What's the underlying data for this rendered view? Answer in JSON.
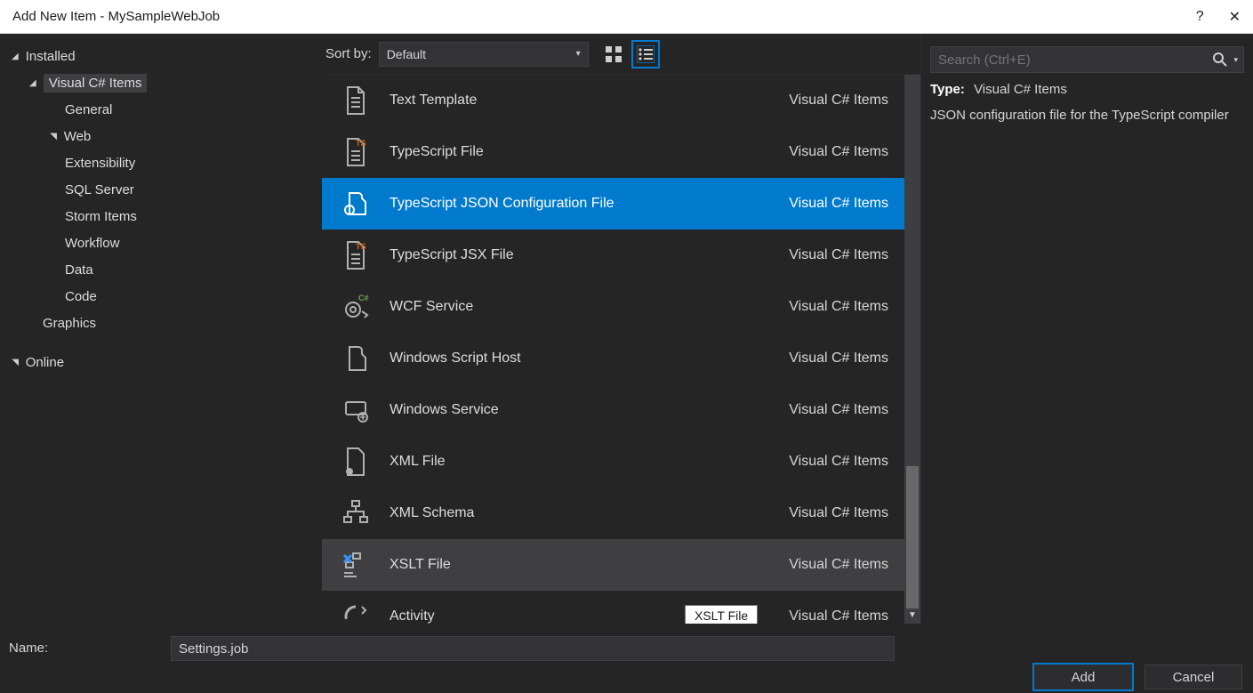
{
  "window": {
    "title": "Add New Item - MySampleWebJob"
  },
  "sidebar": {
    "installed": "Installed",
    "csharp": "Visual C# Items",
    "items": [
      "General",
      "Web",
      "Extensibility",
      "SQL Server",
      "Storm Items",
      "Workflow",
      "Data",
      "Code"
    ],
    "graphics": "Graphics",
    "online": "Online"
  },
  "toolbar": {
    "sortby_label": "Sort by:",
    "sort_value": "Default"
  },
  "templates": [
    {
      "label": "Text Template",
      "cat": "Visual C# Items"
    },
    {
      "label": "TypeScript File",
      "cat": "Visual C# Items"
    },
    {
      "label": "TypeScript JSON Configuration File",
      "cat": "Visual C# Items",
      "selected": true
    },
    {
      "label": "TypeScript JSX File",
      "cat": "Visual C# Items"
    },
    {
      "label": "WCF Service",
      "cat": "Visual C# Items"
    },
    {
      "label": "Windows Script Host",
      "cat": "Visual C# Items"
    },
    {
      "label": "Windows Service",
      "cat": "Visual C# Items"
    },
    {
      "label": "XML File",
      "cat": "Visual C# Items"
    },
    {
      "label": "XML Schema",
      "cat": "Visual C# Items"
    },
    {
      "label": "XSLT File",
      "cat": "Visual C# Items"
    },
    {
      "label": "Activity",
      "cat": "Visual C# Items"
    }
  ],
  "search": {
    "placeholder": "Search (Ctrl+E)"
  },
  "details": {
    "type_label": "Type:",
    "type_value": "Visual C# Items",
    "description": "JSON configuration file for the TypeScript compiler"
  },
  "footer": {
    "name_label": "Name:",
    "name_value": "Settings.job",
    "add": "Add",
    "cancel": "Cancel"
  },
  "tooltip": "XSLT File"
}
